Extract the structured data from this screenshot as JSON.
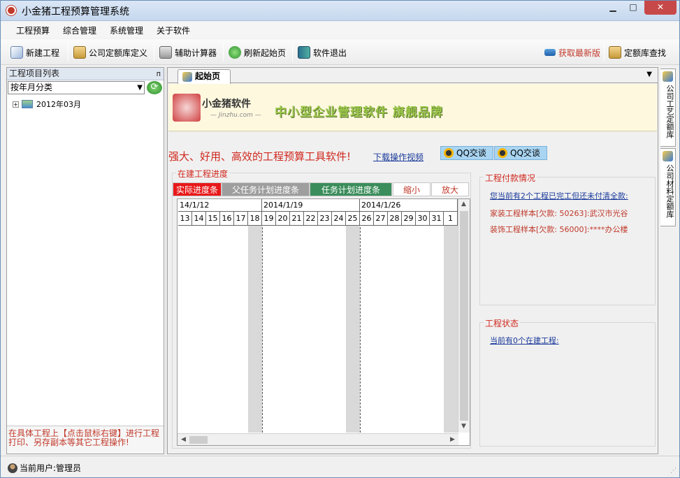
{
  "window": {
    "title": "小金猪工程预算管理系统"
  },
  "menu": [
    "工程预算",
    "综合管理",
    "系统管理",
    "关于软件"
  ],
  "toolbar": {
    "new_project": "新建工程",
    "company_quota": "公司定额库定义",
    "calculator": "辅助计算器",
    "refresh_home": "刷新起始页",
    "exit": "软件退出",
    "get_latest": "获取最新版",
    "quota_search": "定额库查找"
  },
  "left_panel": {
    "title": "工程项目列表",
    "pin": "ᴨ",
    "select_value": "按年月分类",
    "tree_items": [
      {
        "label": "2012年03月"
      }
    ],
    "footer_tip": "在具体工程上【点击鼠标右键】进行工程打印、另存副本等其它工程操作!"
  },
  "main": {
    "tab_label": "起始页",
    "banner": {
      "logo_text": "小金猪软件",
      "logo_sub": "— Jinzhu.com —",
      "slogan": "中小型企业管理软件 旗舰品牌"
    },
    "tagline": "强大、好用、高效的工程预算工具软件!",
    "download_link": "下载操作视频",
    "qq_buttons": [
      "QQ交谈",
      "QQ交谈"
    ],
    "progress": {
      "title": "在建工程进度",
      "buttons": {
        "actual": "实际进度条",
        "parent_plan": "父任务计划进度条",
        "task_plan": "任务计划进度条",
        "zoom_out": "缩小",
        "zoom_in": "放大"
      },
      "weeks": [
        "14/1/12",
        "2014/1/19",
        "2014/1/26"
      ],
      "days": [
        "13",
        "14",
        "15",
        "16",
        "17",
        "18",
        "19",
        "20",
        "21",
        "22",
        "23",
        "24",
        "25",
        "26",
        "27",
        "28",
        "29",
        "30",
        "31",
        "1"
      ]
    },
    "payment": {
      "title": "工程付款情况",
      "summary_link": "您当前有2个工程已完工但还未付清全款:",
      "items": [
        "家装工程样本[欠款: 50263]:武汉市光谷",
        "装饰工程样本[欠款: 56000]:****办公楼"
      ]
    },
    "status": {
      "title": "工程状态",
      "link": "当前有0个在建工程:"
    }
  },
  "right_tabs": [
    "公司工艺定额库",
    "公司材料定额库"
  ],
  "statusbar": {
    "user": "当前用户:管理员"
  },
  "colors": {
    "actual": "#e8191a",
    "parent_plan": "#9e9e9e",
    "task_plan": "#3b8d5b",
    "weekend": "#d9d9d9"
  }
}
